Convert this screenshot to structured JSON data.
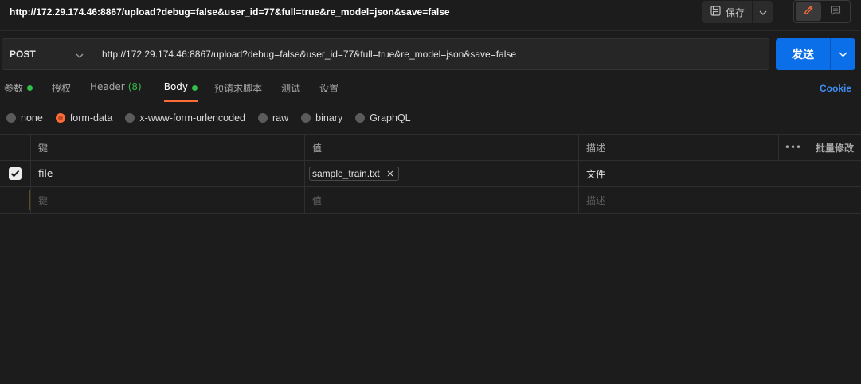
{
  "titlebar": {
    "title": "http://172.29.174.46:8867/upload?debug=false&user_id=77&full=true&re_model=json&save=false",
    "save_label": "保存",
    "save_icon": "save-icon",
    "mode_icons": [
      "pencil-icon",
      "comment-icon"
    ]
  },
  "request": {
    "method": "POST",
    "url": "http://172.29.174.46:8867/upload?debug=false&user_id=77&full=true&re_model=json&save=false",
    "send_label": "发送"
  },
  "tabs": [
    {
      "label": "参数",
      "dot": true
    },
    {
      "label": "授权"
    },
    {
      "label": "Header",
      "count": "(8)"
    },
    {
      "label": "Body",
      "dot": true,
      "active": true
    },
    {
      "label": "预请求脚本"
    },
    {
      "label": "测试"
    },
    {
      "label": "设置"
    }
  ],
  "cookie_label": "Cookie",
  "body_types": [
    {
      "label": "none",
      "selected": false
    },
    {
      "label": "form-data",
      "selected": true
    },
    {
      "label": "x-www-form-urlencoded",
      "selected": false
    },
    {
      "label": "raw",
      "selected": false
    },
    {
      "label": "binary",
      "selected": false
    },
    {
      "label": "GraphQL",
      "selected": false
    }
  ],
  "table": {
    "headers": {
      "key": "键",
      "value": "值",
      "description": "描述",
      "more": "•••",
      "bulk_edit": "批量修改"
    },
    "rows": [
      {
        "checked": true,
        "key": "file",
        "value_file": "sample_train.txt",
        "description": "文件"
      }
    ],
    "placeholder": {
      "key": "键",
      "value": "值",
      "description": "描述"
    }
  },
  "colors": {
    "accent": "#ff6c37",
    "primary": "#0a6fe8",
    "active_dot": "#2fbf4a",
    "link": "#3e8ff5"
  }
}
